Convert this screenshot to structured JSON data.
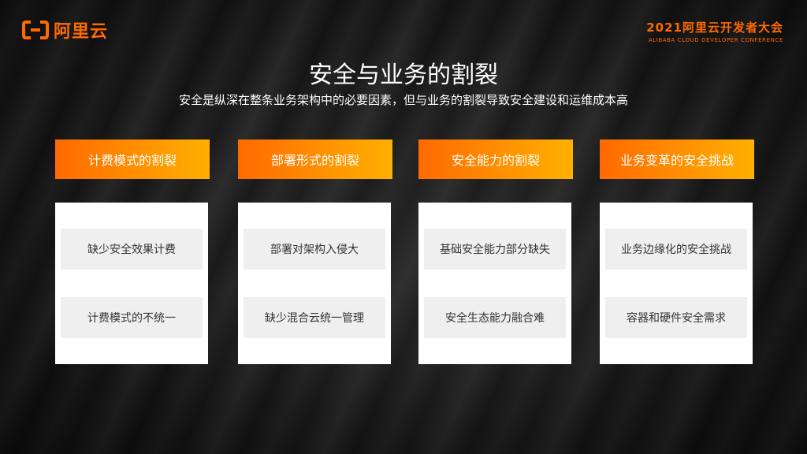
{
  "brand": {
    "logo_text": "阿里云",
    "accent": "#ff6a00"
  },
  "conference": {
    "title": "2021阿里云开发者大会",
    "subtitle": "ALIBABA CLOUD DEVELOPER CONFERENCE"
  },
  "title": "安全与业务的割裂",
  "subtitle": "安全是纵深在整条业务架构中的必要因素，但与业务的割裂导致安全建设和运维成本高",
  "columns": [
    {
      "header": "计费模式的割裂",
      "items": [
        "缺少安全效果计费",
        "计费模式的不统一"
      ]
    },
    {
      "header": "部署形式的割裂",
      "items": [
        "部署对架构入侵大",
        "缺少混合云统一管理"
      ]
    },
    {
      "header": "安全能力的割裂",
      "items": [
        "基础安全能力部分缺失",
        "安全生态能力融合难"
      ]
    },
    {
      "header": "业务变革的安全挑战",
      "items": [
        "业务边缘化的安全挑战",
        "容器和硬件安全需求"
      ]
    }
  ]
}
